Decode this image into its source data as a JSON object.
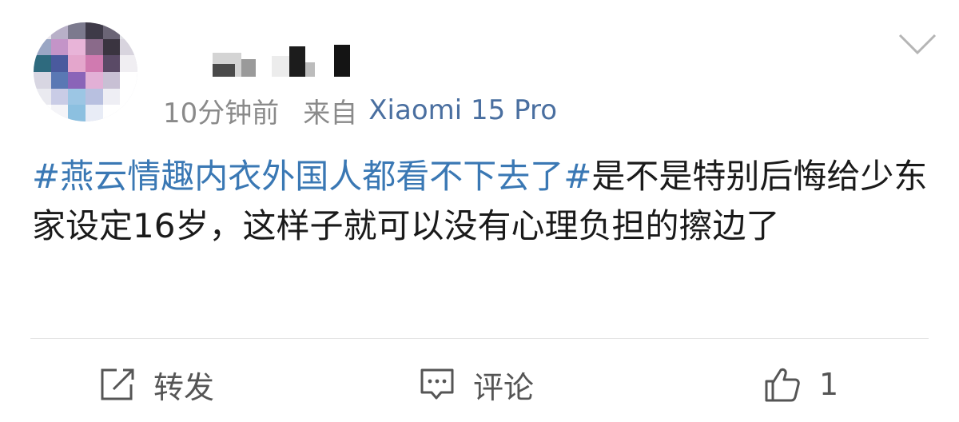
{
  "post": {
    "time": "10分钟前",
    "source_label": "来自",
    "device": "Xiaomi 15 Pro",
    "topic": "#燕云情趣内衣外国人都看不下去了#",
    "body": "是不是特别后悔给少东家设定16岁，这样子就可以没有心理负担的擦边了"
  },
  "actions": {
    "repost_label": "转发",
    "comment_label": "评论",
    "like_count": "1"
  },
  "icons": {
    "chevron": "chevron-down-icon",
    "repost": "repost-icon",
    "comment": "comment-icon",
    "like": "thumbs-up-icon"
  },
  "colors": {
    "topic": "#3a78b4",
    "device": "#4a6fa0",
    "meta": "#8a8a8a",
    "text": "#1a1a1a"
  }
}
